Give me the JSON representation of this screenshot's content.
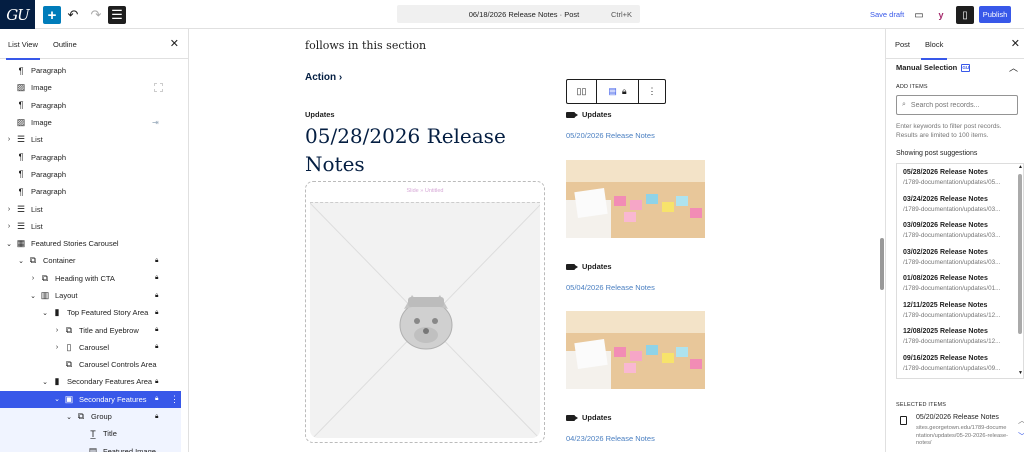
{
  "topbar": {
    "logo": "GU",
    "add_icon": "plus-icon",
    "command_title": "06/18/2026 Release Notes · Post",
    "command_shortcut": "Ctrl+K",
    "save_draft": "Save draft",
    "publish": "Publish"
  },
  "left_panel": {
    "tabs": [
      "List View",
      "Outline"
    ],
    "items": [
      {
        "label": "Paragraph",
        "icon": "paragraph-icon"
      },
      {
        "label": "Image",
        "icon": "image-icon"
      },
      {
        "label": "Paragraph",
        "icon": "paragraph-icon"
      },
      {
        "label": "Image",
        "icon": "image-icon"
      },
      {
        "label": "List",
        "icon": "list-icon"
      },
      {
        "label": "Paragraph",
        "icon": "paragraph-icon"
      },
      {
        "label": "Paragraph",
        "icon": "paragraph-icon"
      },
      {
        "label": "Paragraph",
        "icon": "paragraph-icon"
      },
      {
        "label": "List",
        "icon": "list-icon"
      },
      {
        "label": "List",
        "icon": "list-icon"
      },
      {
        "label": "Featured Stories Carousel",
        "icon": "carousel-block-icon"
      },
      {
        "label": "Container",
        "icon": "group-icon"
      },
      {
        "label": "Heading with CTA",
        "icon": "group-icon"
      },
      {
        "label": "Layout",
        "icon": "columns-icon"
      },
      {
        "label": "Top Featured Story Area",
        "icon": "column-icon"
      },
      {
        "label": "Title and Eyebrow",
        "icon": "group-icon"
      },
      {
        "label": "Carousel",
        "icon": "carousel-icon"
      },
      {
        "label": "Carousel Controls Area",
        "icon": "group-icon"
      },
      {
        "label": "Secondary Features Area",
        "icon": "column-icon"
      },
      {
        "label": "Secondary Features",
        "icon": "query-icon"
      },
      {
        "label": "Group",
        "icon": "group-icon"
      },
      {
        "label": "Title",
        "icon": "title-icon"
      },
      {
        "label": "Featured Image",
        "icon": "featured-image-icon"
      }
    ]
  },
  "canvas": {
    "intro": "follows in this section",
    "action": "Action",
    "updates_label": "Updates",
    "title": "05/28/2026 Release Notes",
    "slide_label": "Slide » Untitled",
    "cards": [
      {
        "label": "Updates",
        "link": "05/20/2026 Release Notes"
      },
      {
        "label": "Updates",
        "link": "05/04/2026 Release Notes"
      },
      {
        "label": "Updates",
        "link": "04/23/2026 Release Notes"
      }
    ]
  },
  "right_panel": {
    "tabs": [
      "Post",
      "Block"
    ],
    "section_title": "Manual Selection",
    "badge": "GU",
    "add_items_label": "ADD ITEMS",
    "search_placeholder": "Search post records...",
    "help": "Enter keywords to filter post records. Results are limited to 100 items.",
    "showing": "Showing post suggestions",
    "suggestions": [
      {
        "title": "05/28/2026 Release Notes",
        "url": "/1789-documentation/updates/05..."
      },
      {
        "title": "03/24/2026 Release Notes",
        "url": "/1789-documentation/updates/03..."
      },
      {
        "title": "03/09/2026 Release Notes",
        "url": "/1789-documentation/updates/03..."
      },
      {
        "title": "03/02/2026 Release Notes",
        "url": "/1789-documentation/updates/03..."
      },
      {
        "title": "01/08/2026 Release Notes",
        "url": "/1789-documentation/updates/01..."
      },
      {
        "title": "12/11/2025 Release Notes",
        "url": "/1789-documentation/updates/12..."
      },
      {
        "title": "12/08/2025 Release Notes",
        "url": "/1789-documentation/updates/12..."
      },
      {
        "title": "09/16/2025 Release Notes",
        "url": "/1789-documentation/updates/09..."
      }
    ],
    "selected_label": "SELECTED ITEMS",
    "selected": {
      "title": "05/20/2026 Release Notes",
      "url": "sites.georgetown.edu/1789-documentation/updates/05-20-2026-release-notes/"
    }
  }
}
